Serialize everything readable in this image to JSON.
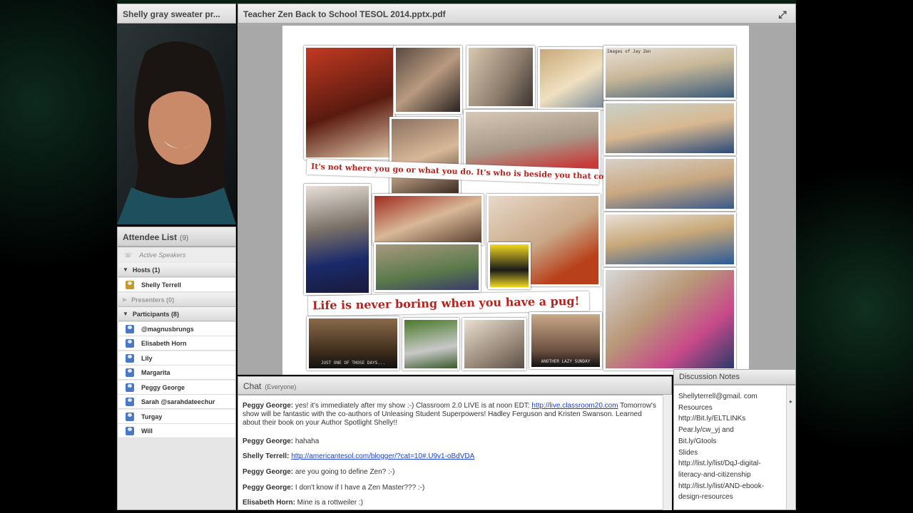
{
  "camera_pod": {
    "title": "Shelly gray sweater pr..."
  },
  "share_pod": {
    "title": "Teacher Zen Back to School TESOL 2014.pptx.pdf",
    "slide": {
      "collage_label": "Images of Jay Zen",
      "caption_top": "It's not where you go or what you do. It's who is beside you that counts!",
      "caption_bottom": "Life is never boring when you have a pug!",
      "poster_left": "JUST ONE OF THOSE DAYS...",
      "poster_right": "ANOTHER LAZY SUNDAY"
    }
  },
  "attendee_pod": {
    "title": "Attendee List",
    "count": "(9)",
    "active_speakers": "Active Speakers",
    "hosts": "Hosts (1)",
    "host_names": [
      "Shelly Terrell"
    ],
    "presenters": "Presenters (0)",
    "participants": "Participants (8)",
    "participant_names": [
      "@magnusbrungs",
      "Elisabeth Horn",
      "Lily",
      "Margarita",
      "Peggy George",
      "Sarah @sarahdateechur",
      "Turgay",
      "Will"
    ]
  },
  "chat_pod": {
    "title": "Chat",
    "scope": "(Everyone)",
    "messages": [
      {
        "who": "Peggy George:",
        "text": " yes! it's immediately after my show :-) Classroom 2.0 LIVE is at noon EDT: ",
        "link": "http://live.classroom20.com",
        "text2": " Tomorrow's show will be fantastic with the co-authors of Unleasing Student Superpowers! Hadley Ferguson and Kristen Swanson. Learned about their book on your Author Spotlight Shelly!!"
      },
      {
        "who": "Peggy George:",
        "text": " hahaha",
        "link": "",
        "text2": ""
      },
      {
        "who": "Shelly Terrell:",
        "text": " ",
        "link": "http://americantesol.com/blogger/?cat=10#.U9v1-oBdVDA",
        "text2": ""
      },
      {
        "who": "Peggy George:",
        "text": " are you going to define Zen? :-)",
        "link": "",
        "text2": ""
      },
      {
        "who": "Peggy George:",
        "text": " I don't know if I have a Zen Master??? :-)",
        "link": "",
        "text2": ""
      },
      {
        "who": "Elisabeth Horn:",
        "text": " Mine is a rottweiler :)",
        "link": "",
        "text2": ""
      }
    ]
  },
  "notes_pod": {
    "title": "Discussion Notes",
    "text": "Shellyterrell@gmail. com\nResources\nhttp://Bit.ly/ELTLINKs\nPear.ly/cw_yj and\nBit.ly/Gtools\nSlides\nhttp://list.ly/list/DqJ-digital-literacy-and-citizenship\nhttp://list.ly/list/AND-ebook-design-resources"
  },
  "colors": {
    "caption_red": "#b8221c",
    "link_blue": "#1a3fd6",
    "desktop": "#000000"
  }
}
